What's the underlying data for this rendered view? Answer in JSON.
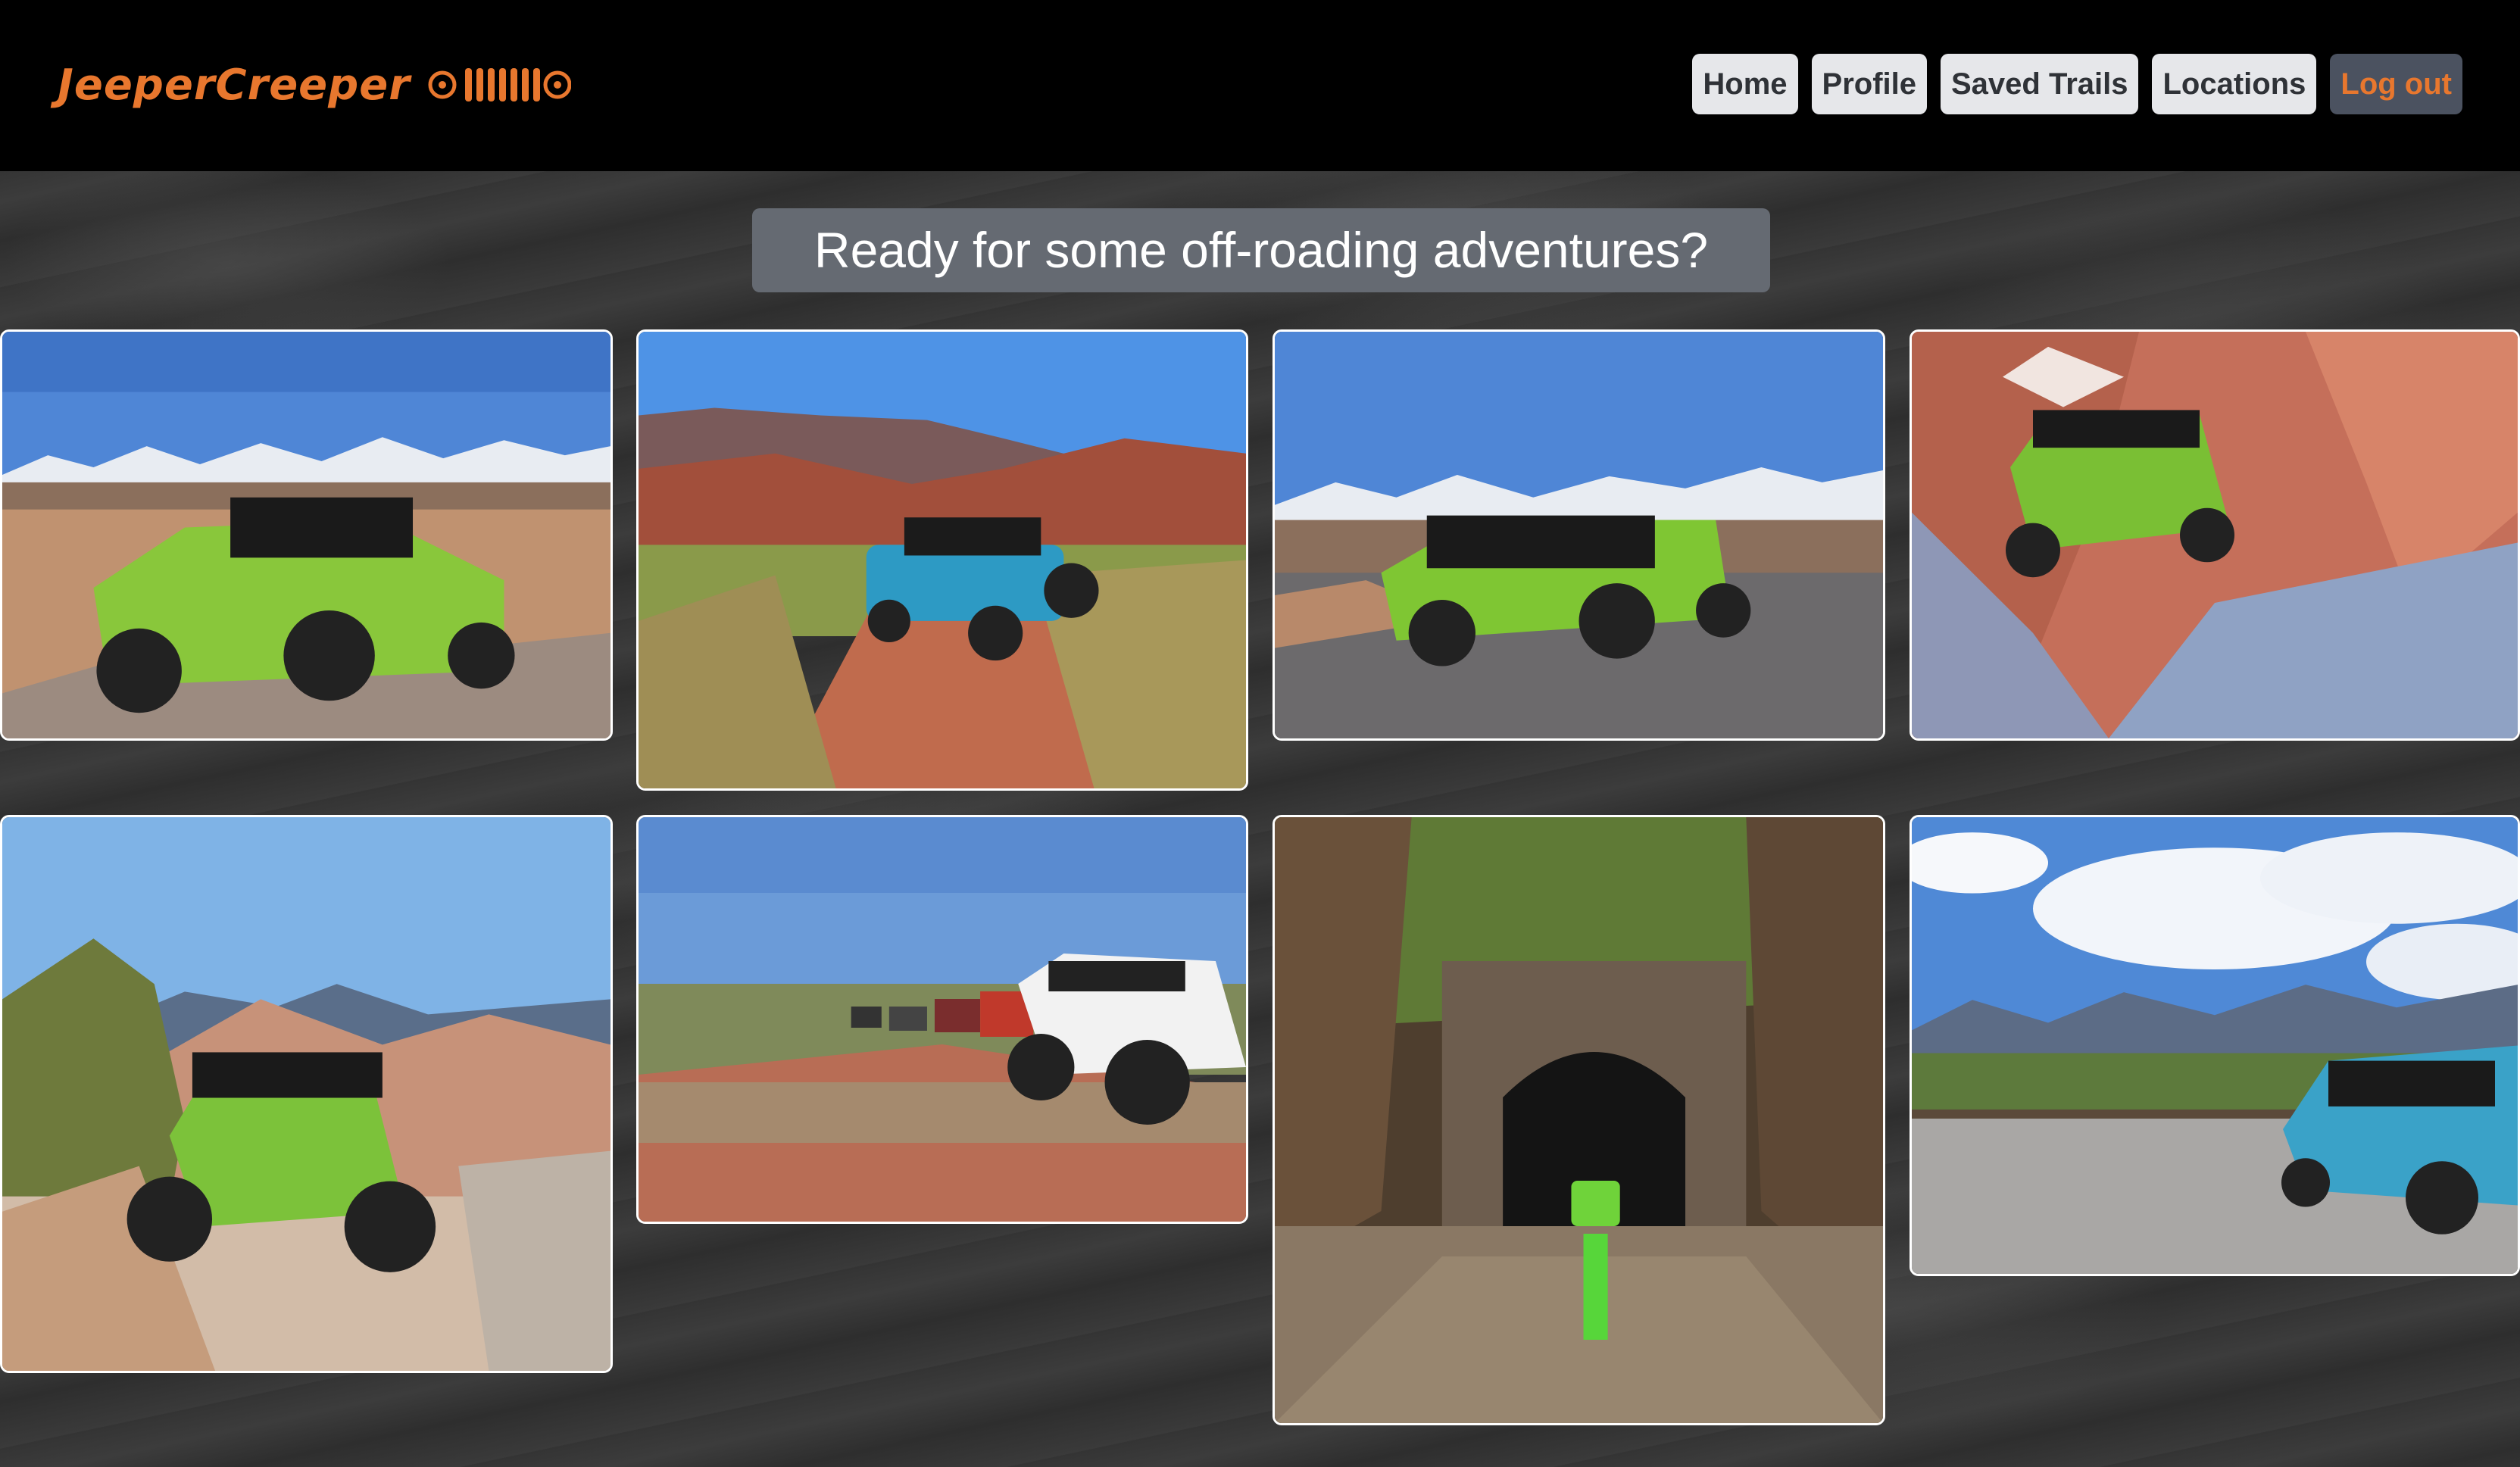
{
  "brand": {
    "name": "JeeperCreeper",
    "accent_color": "#e8772e",
    "logo_icon": "jeep-grille-icon"
  },
  "nav": {
    "items": [
      {
        "label": "Home"
      },
      {
        "label": "Profile"
      },
      {
        "label": "Saved Trails"
      },
      {
        "label": "Locations"
      },
      {
        "label": "Log out"
      }
    ]
  },
  "hero": {
    "headline": "Ready for some off-roading adventures?"
  },
  "gallery": {
    "photos": [
      {
        "subject": "green jeep on slickrock with snowy mountains"
      },
      {
        "subject": "blue jeep on red dirt desert road"
      },
      {
        "subject": "green jeep on rock with snowy peaks"
      },
      {
        "subject": "green jeep climbing red canyon crevice"
      },
      {
        "subject": "green jeep crawling over sandstone domes"
      },
      {
        "subject": "convoy of jeeps on desert trail"
      },
      {
        "subject": "green jeep in stone tunnel with water"
      },
      {
        "subject": "blue jeep parked by fence with mountains and clouds"
      }
    ]
  }
}
